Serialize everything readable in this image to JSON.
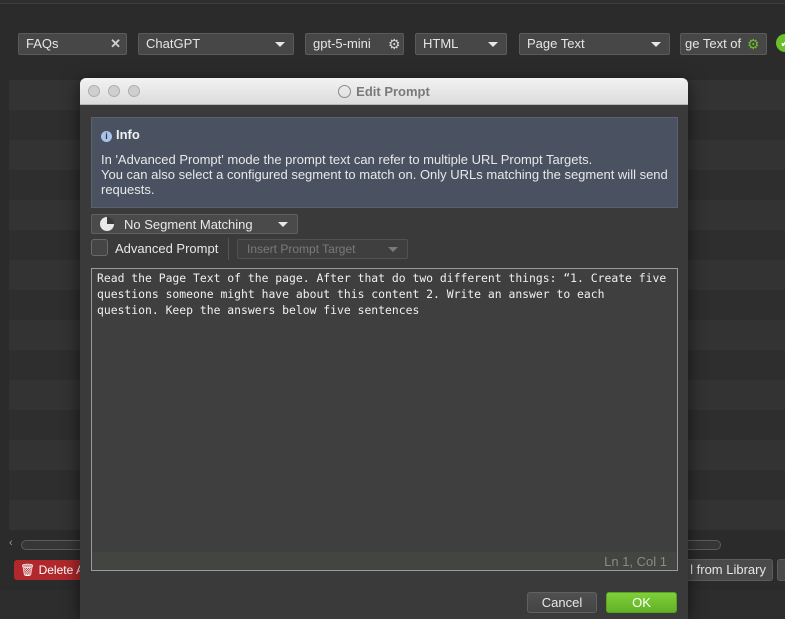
{
  "toolbar": {
    "name_field": "FAQs",
    "provider_select": "ChatGPT",
    "model_field": "gpt-5-mini",
    "format_select": "HTML",
    "source_select": "Page Text",
    "prompt_field": "ge Text of"
  },
  "background": {
    "delete_label": "Delete A",
    "library_label": "l from Library"
  },
  "dialog": {
    "title": "Edit Prompt",
    "info": {
      "heading": "Info",
      "line1": "In 'Advanced Prompt' mode the prompt text can refer to multiple URL Prompt Targets.",
      "line2": "You can also select a configured segment to match on. Only URLs matching the segment will send requests."
    },
    "segment_select": "No Segment Matching",
    "advanced_prompt_label": "Advanced Prompt",
    "advanced_prompt_checked": false,
    "insert_target_placeholder": "Insert Prompt Target",
    "prompt_text": "Read the Page Text of the page. After that do two different things: “1. Create five questions someone might have about this content 2. Write an answer to each question. Keep the answers below five sentences",
    "cursor_status": "Ln 1, Col 1",
    "cancel_label": "Cancel",
    "ok_label": "OK"
  },
  "colors": {
    "accent_green": "#6abf2a",
    "danger_red": "#b0282b",
    "info_panel": "#4a5262"
  }
}
